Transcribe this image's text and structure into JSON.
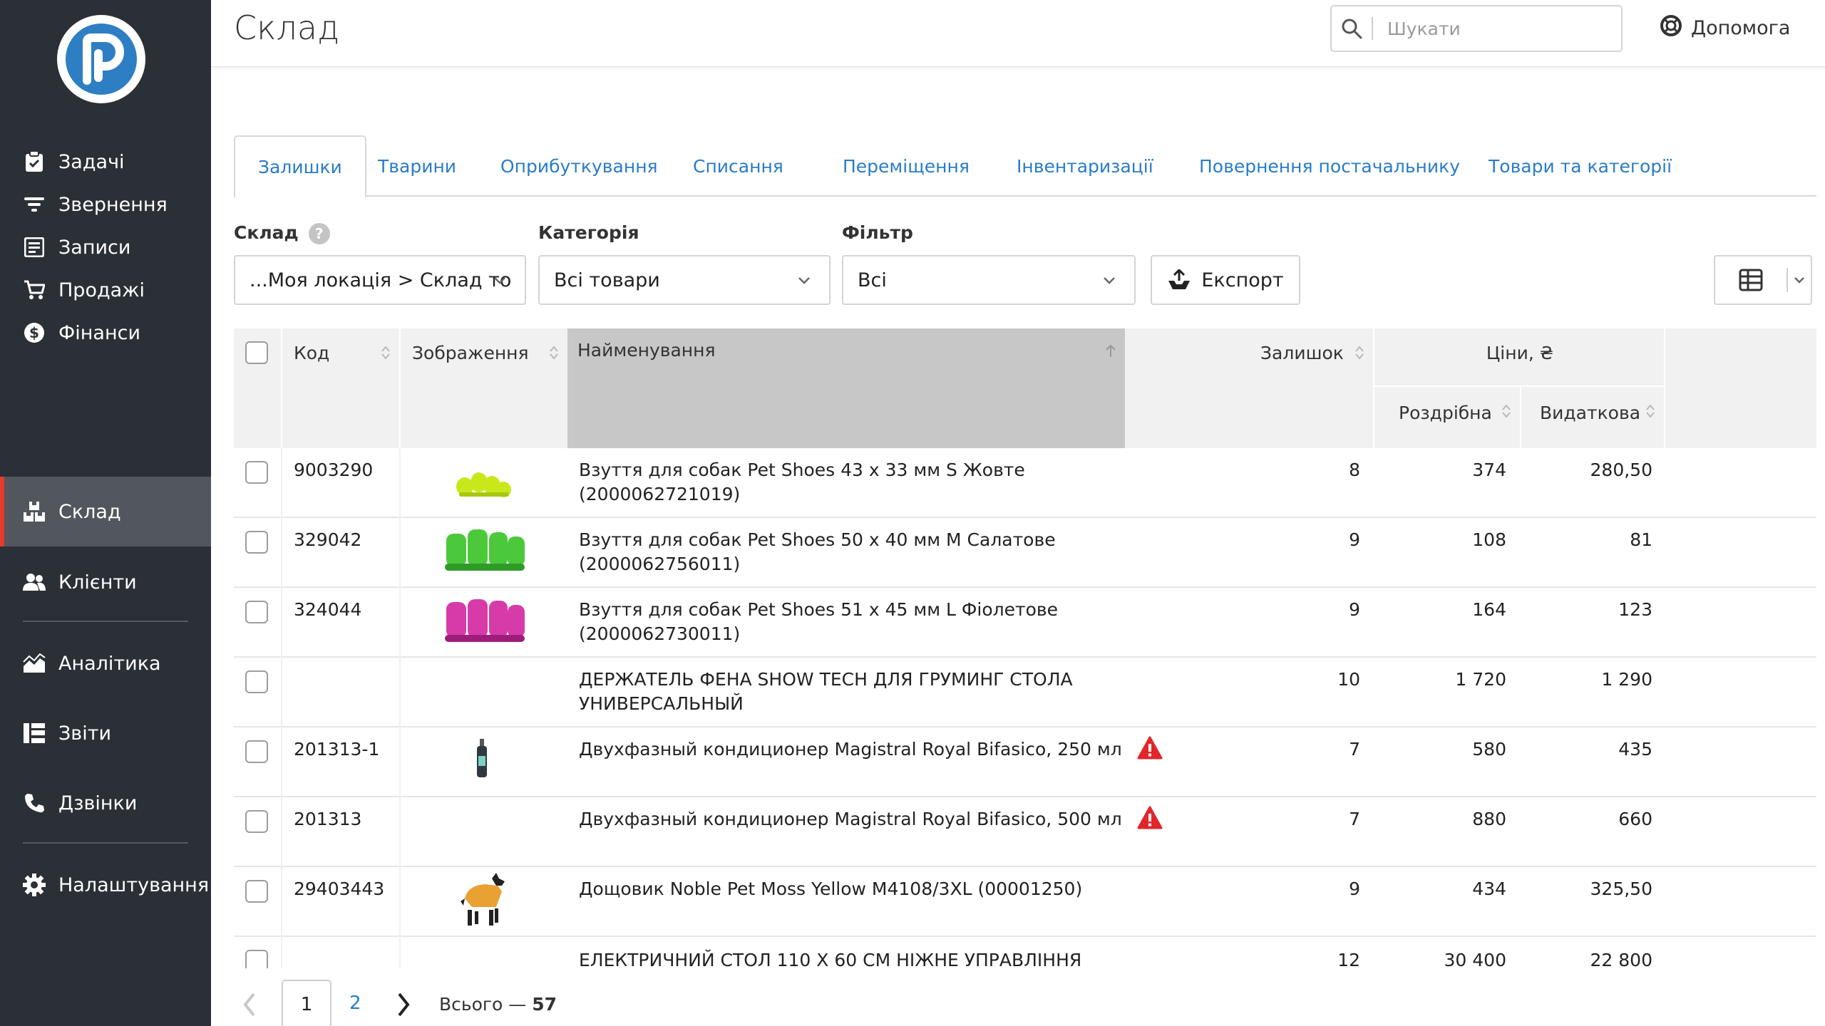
{
  "header": {
    "title": "Склад",
    "search_placeholder": "Шукати",
    "help_label": "Допомога"
  },
  "sidebar": {
    "items": [
      {
        "label": "Задачі",
        "icon": "clipboard-check-icon"
      },
      {
        "label": "Звернення",
        "icon": "filter-icon"
      },
      {
        "label": "Записи",
        "icon": "notes-icon"
      },
      {
        "label": "Продажі",
        "icon": "cart-icon"
      },
      {
        "label": "Фінанси",
        "icon": "dollar-coin-icon"
      },
      {
        "label": "Склад",
        "icon": "boxes-icon",
        "active": true
      },
      {
        "label": "Клієнти",
        "icon": "users-icon"
      },
      {
        "label": "Аналітика",
        "icon": "area-chart-icon"
      },
      {
        "label": "Звіти",
        "icon": "report-list-icon"
      },
      {
        "label": "Дзвінки",
        "icon": "phone-icon"
      },
      {
        "label": "Налаштування",
        "icon": "gear-icon"
      }
    ]
  },
  "tabs": [
    {
      "label": "Залишки",
      "active": true
    },
    {
      "label": "Тварини"
    },
    {
      "label": "Оприбуткування"
    },
    {
      "label": "Списання"
    },
    {
      "label": "Переміщення"
    },
    {
      "label": "Інвентаризації"
    },
    {
      "label": "Повернення постачальнику"
    },
    {
      "label": "Товари та категорії"
    }
  ],
  "filters": {
    "warehouse": {
      "label": "Склад",
      "value": "...Моя локація > Склад то"
    },
    "category": {
      "label": "Категорія",
      "value": "Всі товари"
    },
    "filter": {
      "label": "Фільтр",
      "value": "Всі"
    },
    "export_label": "Експорт"
  },
  "table": {
    "headers": {
      "code": "Код",
      "image": "Зображення",
      "name": "Найменування",
      "stock": "Залишок",
      "prices": "Ціни, ₴",
      "retail": "Роздрібна",
      "expense": "Видаткова"
    },
    "rows": [
      {
        "code": "9003290",
        "name1": "Взуття для собак Pet Shoes 43 x 33 мм S Жовте",
        "name2": "(2000062721019)",
        "stock": "8",
        "retail": "374",
        "expense": "280,50",
        "image": "yellow-shoes",
        "warning": false
      },
      {
        "code": "329042",
        "name1": "Взуття для собак Pet Shoes 50 x 40 мм M Салатове",
        "name2": "(2000062756011)",
        "stock": "9",
        "retail": "108",
        "expense": "81",
        "image": "green-shoes",
        "warning": false
      },
      {
        "code": "324044",
        "name1": "Взуття для собак Pet Shoes 51 x 45 мм L Фіолетове",
        "name2": "(2000062730011)",
        "stock": "9",
        "retail": "164",
        "expense": "123",
        "image": "purple-shoes",
        "warning": false
      },
      {
        "code": "",
        "name1": "ДЕРЖАТЕЛЬ ФЕНА SHOW TECH ДЛЯ ГРУМИНГ СТОЛА",
        "name2": "УНИВЕРСАЛЬНЫЙ",
        "stock": "10",
        "retail": "1 720",
        "expense": "1 290",
        "image": "",
        "warning": false
      },
      {
        "code": "201313-1",
        "name1": "Двухфазный кондиционер Magistral Royal Bifasico, 250 мл",
        "name2": "",
        "stock": "7",
        "retail": "580",
        "expense": "435",
        "image": "bottle",
        "warning": true
      },
      {
        "code": "201313",
        "name1": "Двухфазный кондиционер Magistral Royal Bifasico, 500 мл",
        "name2": "",
        "stock": "7",
        "retail": "880",
        "expense": "660",
        "image": "",
        "warning": true
      },
      {
        "code": "29403443",
        "name1": "Дощовик Noble Pet Moss Yellow M4108/3XL (00001250)",
        "name2": "",
        "stock": "9",
        "retail": "434",
        "expense": "325,50",
        "image": "dog-raincoat",
        "warning": false
      },
      {
        "code": "",
        "name1": "ЕЛЕКТРИЧНИЙ СТОЛ 110 Х 60 СМ НІЖНЕ УПРАВЛІННЯ",
        "name2": "",
        "stock": "12",
        "retail": "30 400",
        "expense": "22 800",
        "image": "",
        "warning": false
      }
    ]
  },
  "pagination": {
    "current": "1",
    "next_page": "2",
    "total_label": "Всього —",
    "total_count": "57"
  },
  "colors": {
    "sidebar_bg": "#2b2f36",
    "sidebar_active": "#52565d",
    "accent_red": "#e63a2e",
    "link_blue": "#2a7cc7",
    "logo_blue": "#2e7ec3"
  }
}
